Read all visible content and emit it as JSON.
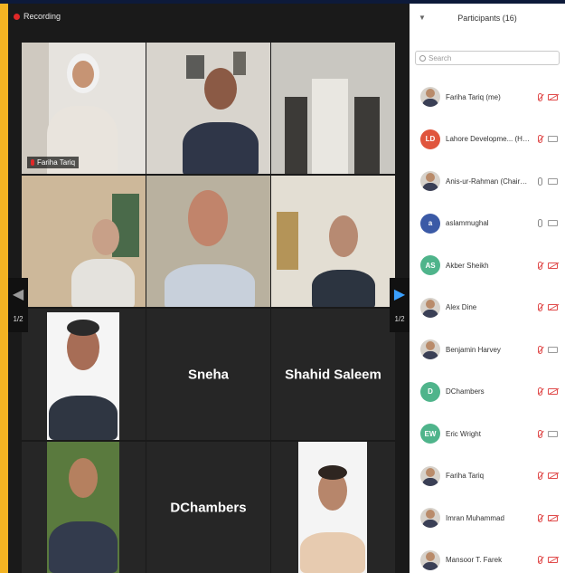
{
  "recording": {
    "label": "Recording"
  },
  "gallery": {
    "tiles": [
      {
        "id": "t1",
        "name_tag": "Fariha Tariq",
        "video": true
      },
      {
        "id": "t2",
        "video": true
      },
      {
        "id": "t3",
        "video": true
      },
      {
        "id": "t4",
        "video": true
      },
      {
        "id": "t5",
        "video": true
      },
      {
        "id": "t6",
        "video": true
      },
      {
        "id": "t7",
        "video": true
      },
      {
        "id": "t8",
        "name": "Sneha",
        "video": false
      },
      {
        "id": "t9",
        "name": "Shahid Saleem",
        "video": false
      },
      {
        "id": "t10",
        "video": true
      },
      {
        "id": "t11",
        "name": "DChambers",
        "video": false
      },
      {
        "id": "t12",
        "video": true
      }
    ],
    "pager_left": "1/2",
    "pager_right": "1/2"
  },
  "panel": {
    "title": "Participants (16)",
    "search_placeholder": "Search",
    "participants": [
      {
        "name": "Fariha Tariq (me)",
        "avatar": "photo",
        "mic": "off",
        "cam": "off"
      },
      {
        "name": "Lahore Developme...  (Host)",
        "avatar": "LD",
        "color": "#e0553d",
        "mic": "off",
        "cam": "on"
      },
      {
        "name": "Anis-ur-Rahman (Chairman...",
        "avatar": "photo",
        "mic": "on",
        "cam": "on"
      },
      {
        "name": "aslammughal",
        "avatar": "a",
        "color": "#3b5aa6",
        "mic": "on",
        "cam": "on"
      },
      {
        "name": "Akber Sheikh",
        "avatar": "AS",
        "color": "#4fb48b",
        "mic": "off",
        "cam": "off"
      },
      {
        "name": "Alex Dine",
        "avatar": "photo",
        "mic": "off",
        "cam": "off"
      },
      {
        "name": "Benjamin Harvey",
        "avatar": "photo",
        "mic": "off",
        "cam": "on"
      },
      {
        "name": "DChambers",
        "avatar": "D",
        "color": "#4fb48b",
        "mic": "off",
        "cam": "off"
      },
      {
        "name": "Eric Wright",
        "avatar": "EW",
        "color": "#4fb48b",
        "mic": "off",
        "cam": "on"
      },
      {
        "name": "Fariha Tariq",
        "avatar": "photo",
        "mic": "off",
        "cam": "off"
      },
      {
        "name": "Imran Muhammad",
        "avatar": "photo",
        "mic": "off",
        "cam": "off"
      },
      {
        "name": "Mansoor T. Farek",
        "avatar": "photo",
        "mic": "off",
        "cam": "off"
      }
    ]
  },
  "colors": {
    "accent": "#f3b323",
    "active_speaker": "#b7c24a",
    "pager_arrow": "#3aa0ff",
    "muted": "#e04b4b"
  }
}
